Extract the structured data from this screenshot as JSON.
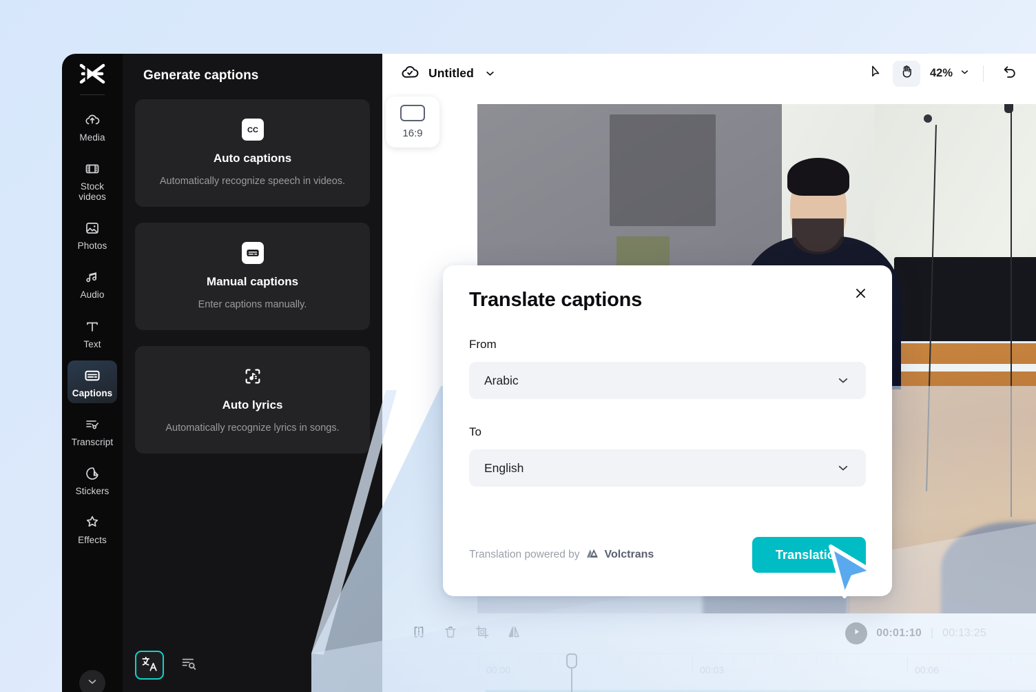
{
  "app": {
    "logo_icon": "capcut-logo-icon"
  },
  "sidebar": {
    "items": [
      {
        "label": "Media",
        "icon": "cloud-upload-icon",
        "active": false
      },
      {
        "label": "Stock videos",
        "icon": "film-strip-icon",
        "active": false
      },
      {
        "label": "Photos",
        "icon": "image-icon",
        "active": false
      },
      {
        "label": "Audio",
        "icon": "music-note-icon",
        "active": false
      },
      {
        "label": "Text",
        "icon": "text-t-icon",
        "active": false
      },
      {
        "label": "Captions",
        "icon": "captions-icon",
        "active": true
      },
      {
        "label": "Transcript",
        "icon": "transcript-icon",
        "active": false
      },
      {
        "label": "Stickers",
        "icon": "sticker-icon",
        "active": false
      },
      {
        "label": "Effects",
        "icon": "sparkle-star-icon",
        "active": false
      }
    ],
    "more_icon": "chevron-down-icon"
  },
  "panel": {
    "title": "Generate captions",
    "cards": [
      {
        "icon": "cc-icon",
        "title": "Auto captions",
        "desc": "Automatically recognize speech in videos."
      },
      {
        "icon": "manual-captions-icon",
        "title": "Manual captions",
        "desc": "Enter captions manually."
      },
      {
        "icon": "auto-lyrics-icon",
        "title": "Auto lyrics",
        "desc": "Automatically recognize lyrics in songs."
      }
    ],
    "footer": {
      "translate_icon": "translate-language-icon",
      "search_icon": "search-list-icon"
    }
  },
  "toolbar": {
    "cloud_icon": "cloud-check-icon",
    "project_title": "Untitled",
    "title_chevron_icon": "chevron-down-icon",
    "select_tool_icon": "cursor-arrow-icon",
    "hand_tool_icon": "hand-icon",
    "zoom_value": "42%",
    "zoom_chevron_icon": "chevron-down-icon",
    "undo_icon": "undo-arrow-icon"
  },
  "preview": {
    "ratio_icon": "aspect-ratio-icon",
    "ratio_label": "16:9"
  },
  "bottom_tools": {
    "split_icon": "split-clip-icon",
    "delete_icon": "trash-icon",
    "crop_icon": "crop-icon",
    "mirror_icon": "mirror-flip-icon",
    "play_icon": "play-icon",
    "current_time": "00:01:10",
    "time_separator": "|",
    "total_time": "00:13:25"
  },
  "timeline": {
    "labels": [
      "00:00",
      "00:03",
      "00:06"
    ]
  },
  "modal": {
    "title": "Translate captions",
    "close_icon": "close-x-icon",
    "from_label": "From",
    "from_value": "Arabic",
    "from_chevron_icon": "chevron-down-icon",
    "to_label": "To",
    "to_value": "English",
    "to_chevron_icon": "chevron-down-icon",
    "powered_by_text": "Translation powered by",
    "powered_by_logo_icon": "volctrans-logo-icon",
    "powered_by_brand": "Volctrans",
    "submit_label": "Translation"
  },
  "cursor": {
    "icon": "mouse-pointer-icon"
  },
  "colors": {
    "accent_teal": "#00bcc4",
    "highlight_teal": "#12d2c8",
    "panel_bg": "#141416",
    "rail_bg": "#0a0a0b",
    "card_bg": "#232326",
    "page_bg": "#dce9fb"
  }
}
